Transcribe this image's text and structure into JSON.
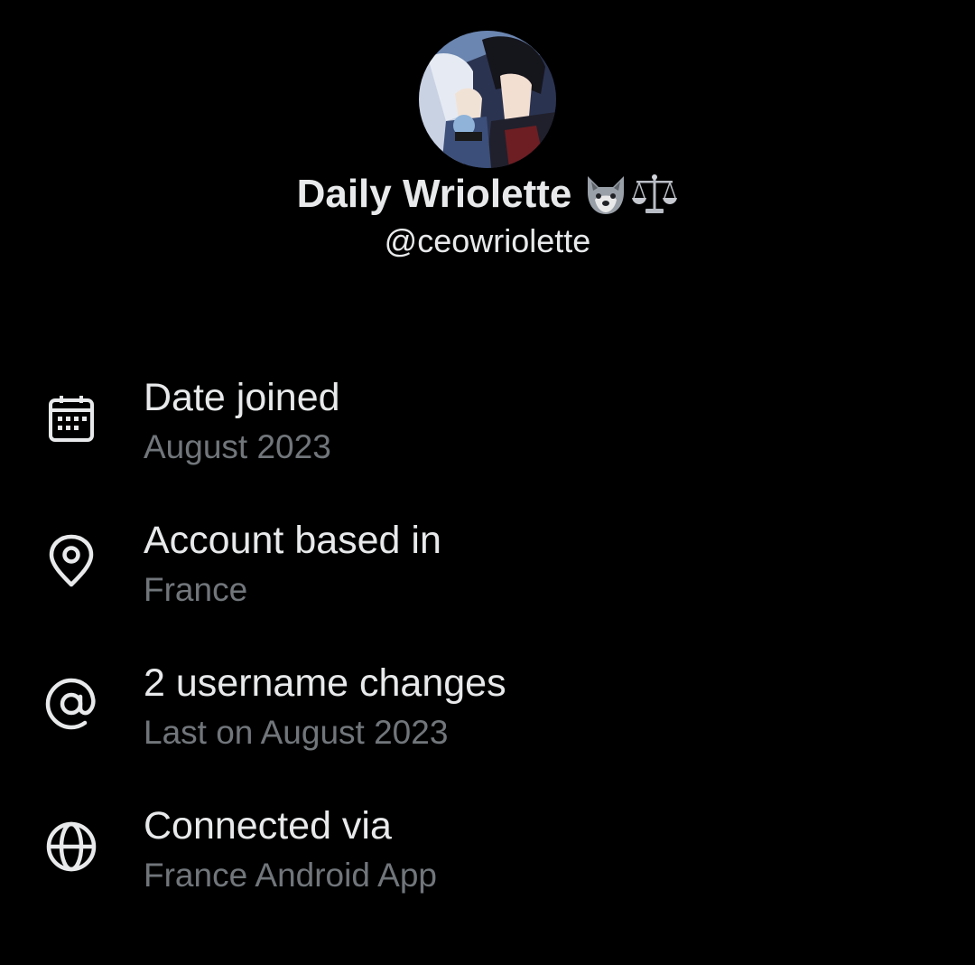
{
  "profile": {
    "display_name": "Daily Wriolette",
    "handle": "@ceowriolette",
    "name_emojis": [
      "wolf-emoji",
      "balance-scale-emoji"
    ]
  },
  "info": [
    {
      "icon": "calendar-icon",
      "title": "Date joined",
      "subtitle": "August 2023"
    },
    {
      "icon": "location-pin-icon",
      "title": "Account based in",
      "subtitle": "France"
    },
    {
      "icon": "at-sign-icon",
      "title": "2 username changes",
      "subtitle": "Last on August 2023"
    },
    {
      "icon": "globe-icon",
      "title": "Connected via",
      "subtitle": "France Android App"
    }
  ],
  "colors": {
    "background": "#000000",
    "primary_text": "#e7e9ea",
    "secondary_text": "#71767b"
  }
}
